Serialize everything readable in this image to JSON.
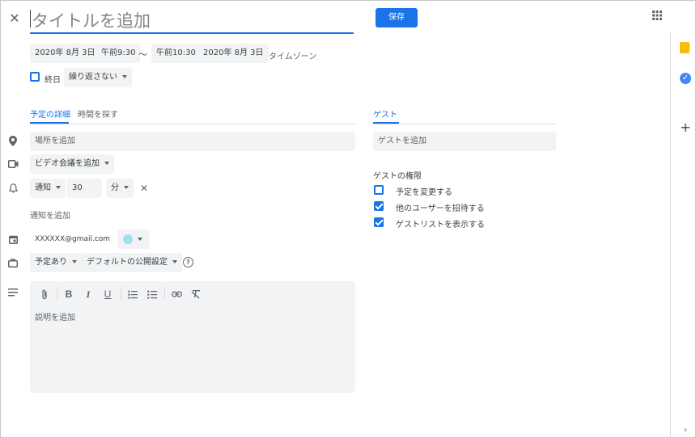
{
  "header": {
    "title_placeholder": "タイトルを追加",
    "save_label": "保存"
  },
  "datetime": {
    "start_date": "2020年 8月 3日",
    "start_time": "午前9:30",
    "separator": "〜",
    "end_time": "午前10:30",
    "end_date": "2020年 8月 3日",
    "timezone": "タイムゾーン",
    "all_day_label": "終日",
    "repeat": "繰り返さない"
  },
  "tabs": {
    "details": "予定の詳細",
    "find_time": "時間を探す",
    "guests": "ゲスト"
  },
  "details": {
    "location_placeholder": "場所を追加",
    "video": "ビデオ会議を追加",
    "notify_type": "通知",
    "notify_value": "30",
    "notify_unit": "分",
    "add_notification": "通知を追加",
    "calendar_account": "XXXXXX@gmail.com",
    "busy": "予定あり",
    "visibility": "デフォルトの公開設定",
    "description_placeholder": "説明を追加"
  },
  "guests": {
    "add_placeholder": "ゲストを追加",
    "permissions_title": "ゲストの権限",
    "permissions": [
      {
        "label": "予定を変更する",
        "checked": false
      },
      {
        "label": "他のユーザーを招待する",
        "checked": true
      },
      {
        "label": "ゲストリストを表示する",
        "checked": true
      }
    ]
  },
  "colors": {
    "accent": "#1a73e8",
    "event_color": "#9fe1e7"
  }
}
